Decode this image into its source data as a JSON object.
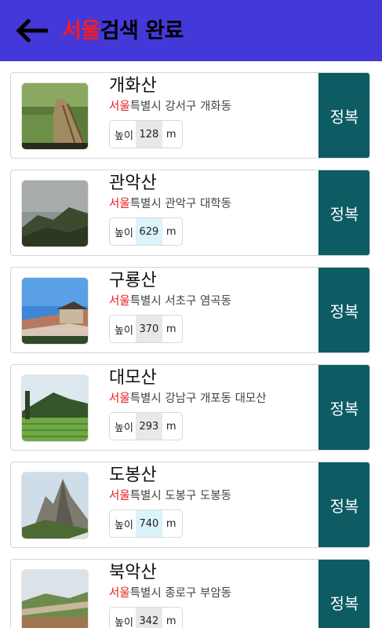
{
  "appbar": {
    "back_icon": "arrow-left-icon",
    "title_highlight": "서울",
    "title_rest": "검색 완료",
    "background": "#4538d8",
    "highlight_color": "#ff1a1a"
  },
  "mountains": [
    {
      "name": "개화산",
      "city": "서울",
      "address_rest": "특별시 강서구 개화동",
      "height_label": "높이",
      "height": "128",
      "unit": "m",
      "action": "정복"
    },
    {
      "name": "관악산",
      "city": "서울",
      "address_rest": "특별시 관악구 대학동",
      "height_label": "높이",
      "height": "629",
      "unit": "m",
      "action": "정복"
    },
    {
      "name": "구룡산",
      "city": "서울",
      "address_rest": "특별시 서초구 염곡동",
      "height_label": "높이",
      "height": "370",
      "unit": "m",
      "action": "정복"
    },
    {
      "name": "대모산",
      "city": "서울",
      "address_rest": "특별시 강남구 개포동 대모산",
      "height_label": "높이",
      "height": "293",
      "unit": "m",
      "action": "정복"
    },
    {
      "name": "도봉산",
      "city": "서울",
      "address_rest": "특별시 도봉구 도봉동",
      "height_label": "높이",
      "height": "740",
      "unit": "m",
      "action": "정복"
    },
    {
      "name": "북악산",
      "city": "서울",
      "address_rest": "특별시 종로구 부암동",
      "height_label": "높이",
      "height": "342",
      "unit": "m",
      "action": "정복"
    }
  ],
  "colors": {
    "action_button": "#0d5b63",
    "city_text": "#e51c1c"
  }
}
